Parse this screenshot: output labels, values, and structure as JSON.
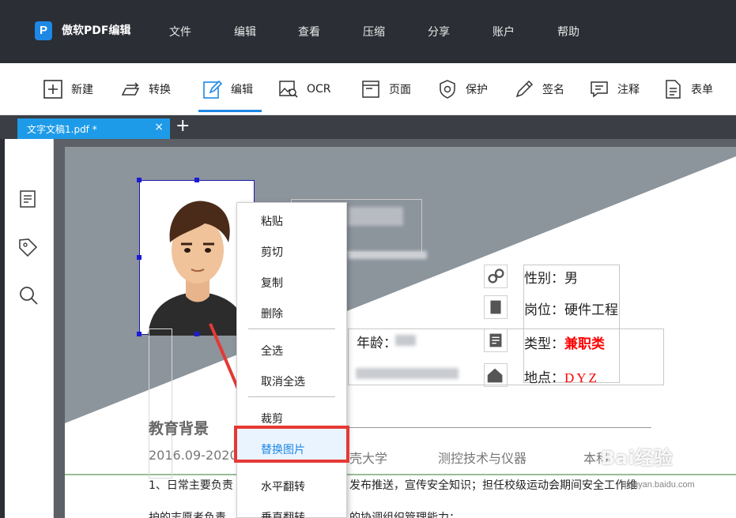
{
  "app": {
    "logo_letter": "P",
    "title": "傲软PDF编辑"
  },
  "menu": [
    "文件",
    "编辑",
    "查看",
    "压缩",
    "分享",
    "账户",
    "帮助"
  ],
  "toolbar": {
    "items": [
      {
        "label": "新建",
        "icon": "plus-box-icon"
      },
      {
        "label": "转换",
        "icon": "convert-icon"
      },
      {
        "label": "编辑",
        "icon": "edit-pen-icon",
        "active": true
      },
      {
        "label": "OCR",
        "icon": "ocr-image-search-icon"
      },
      {
        "label": "页面",
        "icon": "page-icon"
      },
      {
        "label": "保护",
        "icon": "shield-icon"
      },
      {
        "label": "签名",
        "icon": "pen-sign-icon"
      },
      {
        "label": "注释",
        "icon": "comment-icon"
      },
      {
        "label": "表单",
        "icon": "form-icon"
      }
    ],
    "active_color": "#1e88e5"
  },
  "tabs": [
    {
      "label": "文字文稿1.pdf *",
      "close": "×"
    }
  ],
  "tab_add": "+",
  "sidebar_icons": [
    "thumbnail-icon",
    "bookmark-tag-icon",
    "search-icon"
  ],
  "resume": {
    "gender": "性别：男",
    "position_label": "岗位：",
    "position_value": "硬件工程",
    "type_label": "类型：",
    "type_value": "兼职类",
    "location_label": "地点：",
    "location_value": "DYZ",
    "age_label": "年龄：",
    "section_title": "教育背景",
    "edu_date": "2016.09-2020",
    "edu_school": "壳大学",
    "edu_major": "测控技术与仪器",
    "edu_degree": "本科",
    "line1_start": "1、日常主要负责",
    "line1_end": "发布推送，宣传安全知识；担任校级运动会期间安全工作维",
    "line2_start": "护的志愿者负责",
    "line2_end": "的协调组织管理能力；",
    "highlight_color": "#ff0000"
  },
  "context_menu": {
    "items": [
      "粘贴",
      "剪切",
      "复制",
      "删除",
      "全选",
      "取消全选",
      "裁剪",
      "替换图片",
      "水平翻转",
      "垂直翻转"
    ],
    "highlighted": "替换图片",
    "highlight_frame_color": "#e53935"
  },
  "watermark": {
    "text": "Bai经验",
    "sub": "jingyan.baidu.com"
  }
}
